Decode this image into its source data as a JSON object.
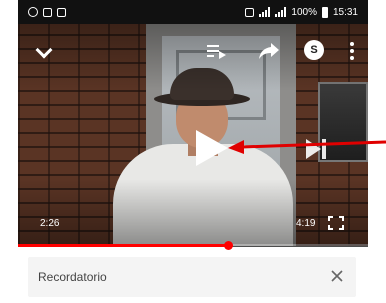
{
  "status_bar": {
    "right_text": "100%",
    "clock": "15:31"
  },
  "player": {
    "account_letter": "S",
    "time_current": "2:26",
    "time_total": "4:19",
    "progress_fraction": 0.6,
    "accent_color": "#ff0000"
  },
  "panel": {
    "reminder_title": "Recordatorio"
  },
  "annotation": {
    "arrow_color": "#e00000"
  }
}
